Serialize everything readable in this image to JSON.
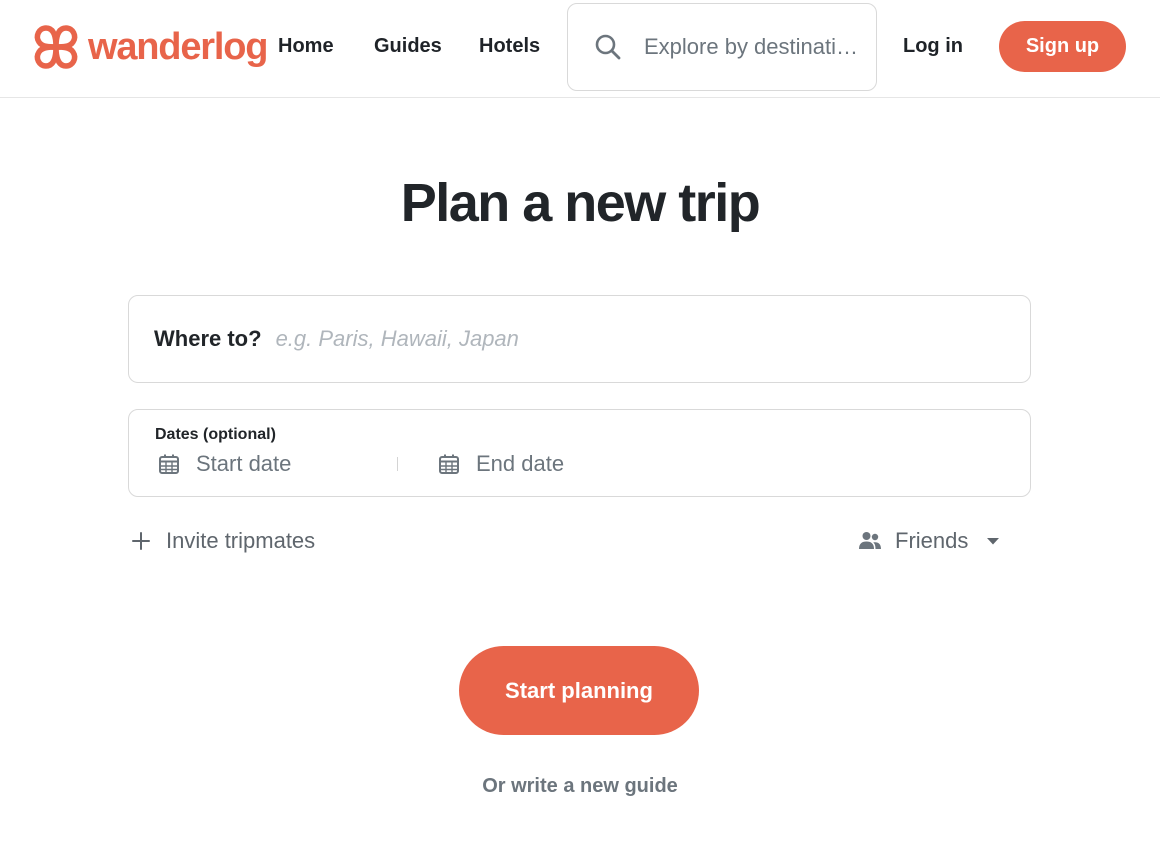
{
  "brand": {
    "name": "wanderlog",
    "accent_color": "#e8644a",
    "logo_icon": "wanderlog-logo-icon"
  },
  "header": {
    "nav": [
      "Home",
      "Guides",
      "Hotels"
    ],
    "search": {
      "icon": "search-icon",
      "placeholder": "Explore by destination"
    },
    "login_label": "Log in",
    "signup_label": "Sign up"
  },
  "main": {
    "title": "Plan a new trip",
    "where": {
      "label": "Where to?",
      "placeholder": "e.g. Paris, Hawaii, Japan"
    },
    "dates": {
      "label": "Dates (optional)",
      "start_placeholder": "Start date",
      "end_placeholder": "End date",
      "icon": "calendar-icon"
    },
    "invite": {
      "label": "Invite tripmates",
      "icon": "plus-icon"
    },
    "visibility": {
      "selected": "Friends",
      "icon": "people-icon",
      "caret_icon": "caret-down-icon"
    },
    "start_button": "Start planning",
    "guide_link": "Or write a new guide"
  }
}
